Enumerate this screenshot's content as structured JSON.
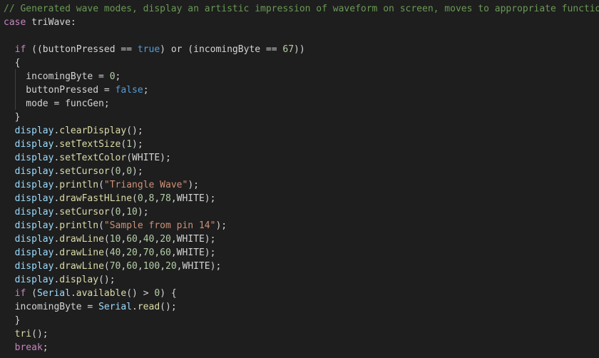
{
  "editor": {
    "language": "arduino-cpp",
    "colors": {
      "background": "#1e1e1e",
      "text": "#d4d4d4",
      "comment": "#6a9955",
      "keyword": "#c586c0",
      "boolean": "#569cd6",
      "number": "#b5cea8",
      "string": "#ce9178",
      "function": "#dcdcaa",
      "identifier": "#9cdcfe"
    },
    "lines": [
      [
        {
          "t": "// Generated wave modes, display an artistic impression of waveform on screen, moves to appropriate function",
          "c": "comment"
        }
      ],
      [
        {
          "t": "case ",
          "c": "kw"
        },
        {
          "t": "triWave:",
          "c": "def"
        }
      ],
      [],
      [
        {
          "t": "  ",
          "c": "def"
        },
        {
          "t": "if",
          "c": "kw"
        },
        {
          "t": " ((buttonPressed == ",
          "c": "def"
        },
        {
          "t": "true",
          "c": "bool"
        },
        {
          "t": ") ",
          "c": "def"
        },
        {
          "t": "or",
          "c": "def"
        },
        {
          "t": " (incomingByte == ",
          "c": "def"
        },
        {
          "t": "67",
          "c": "num"
        },
        {
          "t": "))",
          "c": "def"
        }
      ],
      [
        {
          "t": "  {",
          "c": "def"
        }
      ],
      [
        {
          "t": "    incomingByte = ",
          "c": "def"
        },
        {
          "t": "0",
          "c": "num"
        },
        {
          "t": ";",
          "c": "def"
        }
      ],
      [
        {
          "t": "    buttonPressed = ",
          "c": "def"
        },
        {
          "t": "false",
          "c": "bool"
        },
        {
          "t": ";",
          "c": "def"
        }
      ],
      [
        {
          "t": "    mode = funcGen;",
          "c": "def"
        }
      ],
      [
        {
          "t": "  }",
          "c": "def"
        }
      ],
      [
        {
          "t": "  ",
          "c": "def"
        },
        {
          "t": "display",
          "c": "id"
        },
        {
          "t": ".",
          "c": "def"
        },
        {
          "t": "clearDisplay",
          "c": "fn"
        },
        {
          "t": "();",
          "c": "def"
        }
      ],
      [
        {
          "t": "  ",
          "c": "def"
        },
        {
          "t": "display",
          "c": "id"
        },
        {
          "t": ".",
          "c": "def"
        },
        {
          "t": "setTextSize",
          "c": "fn"
        },
        {
          "t": "(",
          "c": "def"
        },
        {
          "t": "1",
          "c": "num"
        },
        {
          "t": ");",
          "c": "def"
        }
      ],
      [
        {
          "t": "  ",
          "c": "def"
        },
        {
          "t": "display",
          "c": "id"
        },
        {
          "t": ".",
          "c": "def"
        },
        {
          "t": "setTextColor",
          "c": "fn"
        },
        {
          "t": "(WHITE);",
          "c": "def"
        }
      ],
      [
        {
          "t": "  ",
          "c": "def"
        },
        {
          "t": "display",
          "c": "id"
        },
        {
          "t": ".",
          "c": "def"
        },
        {
          "t": "setCursor",
          "c": "fn"
        },
        {
          "t": "(",
          "c": "def"
        },
        {
          "t": "0",
          "c": "num"
        },
        {
          "t": ",",
          "c": "def"
        },
        {
          "t": "0",
          "c": "num"
        },
        {
          "t": ");",
          "c": "def"
        }
      ],
      [
        {
          "t": "  ",
          "c": "def"
        },
        {
          "t": "display",
          "c": "id"
        },
        {
          "t": ".",
          "c": "def"
        },
        {
          "t": "println",
          "c": "fn"
        },
        {
          "t": "(",
          "c": "def"
        },
        {
          "t": "\"Triangle Wave\"",
          "c": "str"
        },
        {
          "t": ");",
          "c": "def"
        }
      ],
      [
        {
          "t": "  ",
          "c": "def"
        },
        {
          "t": "display",
          "c": "id"
        },
        {
          "t": ".",
          "c": "def"
        },
        {
          "t": "drawFastHLine",
          "c": "fn"
        },
        {
          "t": "(",
          "c": "def"
        },
        {
          "t": "0",
          "c": "num"
        },
        {
          "t": ",",
          "c": "def"
        },
        {
          "t": "8",
          "c": "num"
        },
        {
          "t": ",",
          "c": "def"
        },
        {
          "t": "78",
          "c": "num"
        },
        {
          "t": ",WHITE);",
          "c": "def"
        }
      ],
      [
        {
          "t": "  ",
          "c": "def"
        },
        {
          "t": "display",
          "c": "id"
        },
        {
          "t": ".",
          "c": "def"
        },
        {
          "t": "setCursor",
          "c": "fn"
        },
        {
          "t": "(",
          "c": "def"
        },
        {
          "t": "0",
          "c": "num"
        },
        {
          "t": ",",
          "c": "def"
        },
        {
          "t": "10",
          "c": "num"
        },
        {
          "t": ");",
          "c": "def"
        }
      ],
      [
        {
          "t": "  ",
          "c": "def"
        },
        {
          "t": "display",
          "c": "id"
        },
        {
          "t": ".",
          "c": "def"
        },
        {
          "t": "println",
          "c": "fn"
        },
        {
          "t": "(",
          "c": "def"
        },
        {
          "t": "\"Sample from pin 14\"",
          "c": "str"
        },
        {
          "t": ");",
          "c": "def"
        }
      ],
      [
        {
          "t": "  ",
          "c": "def"
        },
        {
          "t": "display",
          "c": "id"
        },
        {
          "t": ".",
          "c": "def"
        },
        {
          "t": "drawLine",
          "c": "fn"
        },
        {
          "t": "(",
          "c": "def"
        },
        {
          "t": "10",
          "c": "num"
        },
        {
          "t": ",",
          "c": "def"
        },
        {
          "t": "60",
          "c": "num"
        },
        {
          "t": ",",
          "c": "def"
        },
        {
          "t": "40",
          "c": "num"
        },
        {
          "t": ",",
          "c": "def"
        },
        {
          "t": "20",
          "c": "num"
        },
        {
          "t": ",WHITE);",
          "c": "def"
        }
      ],
      [
        {
          "t": "  ",
          "c": "def"
        },
        {
          "t": "display",
          "c": "id"
        },
        {
          "t": ".",
          "c": "def"
        },
        {
          "t": "drawLine",
          "c": "fn"
        },
        {
          "t": "(",
          "c": "def"
        },
        {
          "t": "40",
          "c": "num"
        },
        {
          "t": ",",
          "c": "def"
        },
        {
          "t": "20",
          "c": "num"
        },
        {
          "t": ",",
          "c": "def"
        },
        {
          "t": "70",
          "c": "num"
        },
        {
          "t": ",",
          "c": "def"
        },
        {
          "t": "60",
          "c": "num"
        },
        {
          "t": ",WHITE);",
          "c": "def"
        }
      ],
      [
        {
          "t": "  ",
          "c": "def"
        },
        {
          "t": "display",
          "c": "id"
        },
        {
          "t": ".",
          "c": "def"
        },
        {
          "t": "drawLine",
          "c": "fn"
        },
        {
          "t": "(",
          "c": "def"
        },
        {
          "t": "70",
          "c": "num"
        },
        {
          "t": ",",
          "c": "def"
        },
        {
          "t": "60",
          "c": "num"
        },
        {
          "t": ",",
          "c": "def"
        },
        {
          "t": "100",
          "c": "num"
        },
        {
          "t": ",",
          "c": "def"
        },
        {
          "t": "20",
          "c": "num"
        },
        {
          "t": ",WHITE);",
          "c": "def"
        }
      ],
      [
        {
          "t": "  ",
          "c": "def"
        },
        {
          "t": "display",
          "c": "id"
        },
        {
          "t": ".",
          "c": "def"
        },
        {
          "t": "display",
          "c": "fn"
        },
        {
          "t": "();",
          "c": "def"
        }
      ],
      [
        {
          "t": "  ",
          "c": "def"
        },
        {
          "t": "if",
          "c": "kw"
        },
        {
          "t": " (",
          "c": "def"
        },
        {
          "t": "Serial",
          "c": "id"
        },
        {
          "t": ".",
          "c": "def"
        },
        {
          "t": "available",
          "c": "fn"
        },
        {
          "t": "() > ",
          "c": "def"
        },
        {
          "t": "0",
          "c": "num"
        },
        {
          "t": ") {",
          "c": "def"
        }
      ],
      [
        {
          "t": "  incomingByte = ",
          "c": "def"
        },
        {
          "t": "Serial",
          "c": "id"
        },
        {
          "t": ".",
          "c": "def"
        },
        {
          "t": "read",
          "c": "fn"
        },
        {
          "t": "();",
          "c": "def"
        }
      ],
      [
        {
          "t": "  }",
          "c": "def"
        }
      ],
      [
        {
          "t": "  ",
          "c": "def"
        },
        {
          "t": "tri",
          "c": "fn"
        },
        {
          "t": "();",
          "c": "def"
        }
      ],
      [
        {
          "t": "  ",
          "c": "def"
        },
        {
          "t": "break",
          "c": "kw"
        },
        {
          "t": ";",
          "c": "def"
        }
      ]
    ]
  }
}
